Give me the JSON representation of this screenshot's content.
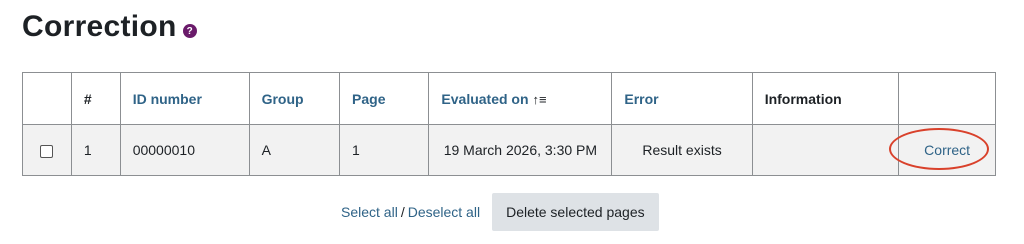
{
  "header": {
    "title": "Correction",
    "help_icon": "question-circle-icon",
    "help_glyph": "?"
  },
  "table": {
    "columns": [
      {
        "label": "",
        "sortable": false
      },
      {
        "label": "#",
        "sortable": false
      },
      {
        "label": "ID number",
        "sortable": true
      },
      {
        "label": "Group",
        "sortable": true
      },
      {
        "label": "Page",
        "sortable": true
      },
      {
        "label": "Evaluated on",
        "sortable": true,
        "sort_icon": "sort-ascending-icon",
        "sort_glyph": "↑≡"
      },
      {
        "label": "Error",
        "sortable": true
      },
      {
        "label": "Information",
        "sortable": false
      },
      {
        "label": "",
        "sortable": false
      }
    ],
    "rows": [
      {
        "checked": false,
        "index": "1",
        "id_number": "00000010",
        "group": "A",
        "page": "1",
        "evaluated_on": "19 March 2026, 3:30 PM",
        "error": "Result exists",
        "information": "",
        "action": "Correct"
      }
    ]
  },
  "actions": {
    "select_all": "Select all",
    "separator": "/",
    "deselect_all": "Deselect all",
    "delete_button": "Delete selected pages"
  },
  "colors": {
    "link": "#2f6387",
    "highlight_oval": "#d9412b",
    "help_icon_bg": "#6a1b6a",
    "button_bg": "#dee2e6"
  }
}
